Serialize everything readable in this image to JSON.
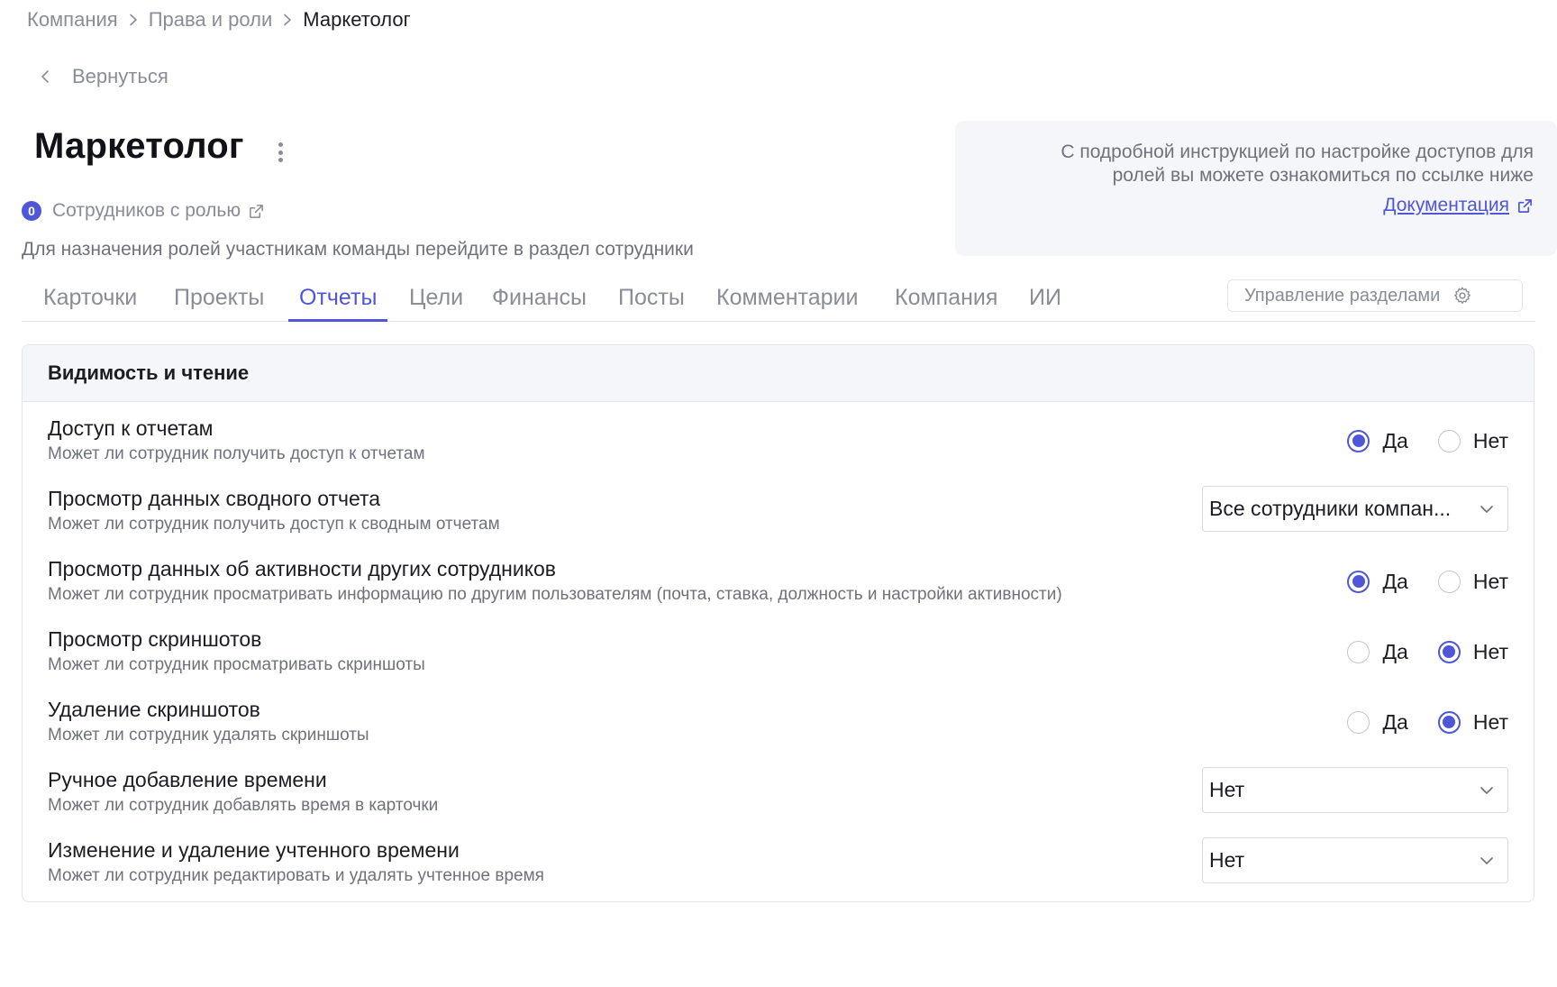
{
  "breadcrumb": [
    "Компания",
    "Права и роли",
    "Маркетолог"
  ],
  "back_label": "Вернуться",
  "role_title": "Маркетолог",
  "employees": {
    "count": "0",
    "label": "Сотрудников с ролью"
  },
  "hint": "Для назначения ролей участникам команды перейдите в раздел сотрудники",
  "info": {
    "line1": "С подробной инструкцией по настройке доступов для",
    "line2": "ролей вы можете ознакомиться по ссылке ниже",
    "link": "Документация"
  },
  "tabs": [
    {
      "label": "Карточки",
      "active": false
    },
    {
      "label": "Проекты",
      "active": false
    },
    {
      "label": "Отчеты",
      "active": true
    },
    {
      "label": "Цели",
      "active": false
    },
    {
      "label": "Финансы",
      "active": false
    },
    {
      "label": "Посты",
      "active": false
    },
    {
      "label": "Комментарии",
      "active": false
    },
    {
      "label": "Компания",
      "active": false
    },
    {
      "label": "ИИ",
      "active": false
    }
  ],
  "manage_sections": "Управление разделами",
  "section_title": "Видимость и чтение",
  "radio_labels": {
    "yes": "Да",
    "no": "Нет"
  },
  "permissions": [
    {
      "title": "Доступ к отчетам",
      "desc": "Может ли сотрудник получить доступ к отчетам",
      "type": "radio",
      "value": "yes"
    },
    {
      "title": "Просмотр данных сводного отчета",
      "desc": "Может ли сотрудник получить доступ к сводным отчетам",
      "type": "select",
      "value": "Все сотрудники компан..."
    },
    {
      "title": "Просмотр данных об активности других сотрудников",
      "desc": "Может ли сотрудник просматривать информацию по другим пользователям (почта, ставка, должность и настройки активности)",
      "type": "radio",
      "value": "yes"
    },
    {
      "title": "Просмотр скриншотов",
      "desc": "Может ли сотрудник просматривать скриншоты",
      "type": "radio",
      "value": "no"
    },
    {
      "title": "Удаление скриншотов",
      "desc": "Может ли сотрудник удалять скриншоты",
      "type": "radio",
      "value": "no"
    },
    {
      "title": "Ручное добавление времени",
      "desc": "Может ли сотрудник добавлять время в карточки",
      "type": "select",
      "value": "Нет"
    },
    {
      "title": "Изменение и удаление учтенного времени",
      "desc": "Может ли сотрудник редактировать и удалять учтенное время",
      "type": "select",
      "value": "Нет"
    }
  ],
  "colors": {
    "accent": "#4f57d6",
    "muted_text": "#8a8d96",
    "info_bg": "#f5f6fa"
  }
}
